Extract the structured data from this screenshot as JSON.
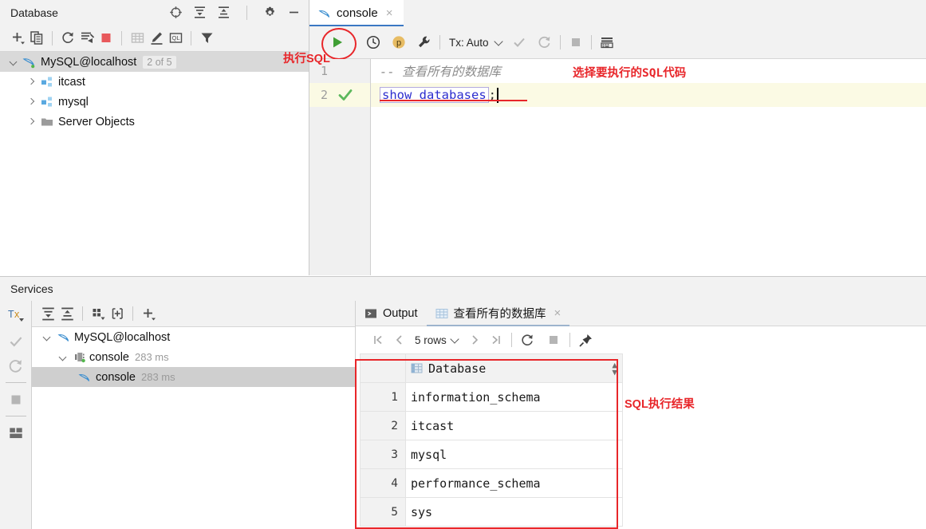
{
  "database_panel": {
    "title": "Database",
    "header_icons": [
      "locate-target-icon",
      "expand-all-icon",
      "collapse-all-icon",
      "settings-gear-icon",
      "minimize-icon"
    ],
    "toolbar_icons": [
      "add-plus-icon",
      "duplicate-icon",
      "refresh-icon",
      "run-script-icon",
      "stop-icon",
      "table-icon",
      "edit-pencil-icon",
      "query-ql-icon",
      "filter-icon"
    ],
    "tree": [
      {
        "label": "MySQL@localhost",
        "badge": "2 of 5",
        "icon": "mysql-dolphin-icon",
        "state": "open",
        "depth": 0,
        "selected": true
      },
      {
        "label": "itcast",
        "badge": "",
        "icon": "schema-icon",
        "state": "closed",
        "depth": 1,
        "selected": false
      },
      {
        "label": "mysql",
        "badge": "",
        "icon": "schema-icon",
        "state": "closed",
        "depth": 1,
        "selected": false
      },
      {
        "label": "Server Objects",
        "badge": "",
        "icon": "folder-icon",
        "state": "closed",
        "depth": 1,
        "selected": false
      }
    ]
  },
  "editor": {
    "tab": {
      "label": "console",
      "icon": "mysql-dolphin-icon",
      "close": "×"
    },
    "toolbar": {
      "run_icon": "run-play-icon",
      "history_icon": "history-clock-icon",
      "profile_icon": "profile-p-icon",
      "settings_icon": "wrench-icon",
      "tx_label": "Tx: Auto",
      "commit_icon": "commit-check-icon",
      "rollback_icon": "rollback-icon",
      "stop_icon": "stop-square-icon",
      "table_editor_icon": "data-editor-icon"
    },
    "lines": [
      {
        "num": "1",
        "status": "",
        "kind": "comment",
        "text": "--  查看所有的数据库",
        "current": false
      },
      {
        "num": "2",
        "status": "check-green-icon",
        "kind": "sql",
        "text": "show databases",
        "terminator": ";",
        "current": true
      }
    ]
  },
  "annotations": [
    {
      "text": "执行SQL",
      "name": "annotation-run-sql"
    },
    {
      "text": "选择要执行的SQL代码",
      "name": "annotation-select-sql"
    },
    {
      "text": "SQL执行结果",
      "name": "annotation-sql-result"
    }
  ],
  "services": {
    "title": "Services",
    "rail_icons": [
      "tx-dropdown-icon",
      "commit-check-icon",
      "rollback-icon",
      "stop-square-icon",
      "layout-icon"
    ],
    "toolbar_icons": [
      "expand-all-icon",
      "collapse-all-icon",
      "group-by-icon",
      "add-frame-icon",
      "add-plus-icon"
    ],
    "tree": [
      {
        "label": "MySQL@localhost",
        "time": "",
        "icon": "mysql-dolphin-icon",
        "state": "open",
        "depth": 0,
        "selected": false
      },
      {
        "label": "console",
        "time": "283 ms",
        "icon": "connection-icon",
        "state": "open",
        "depth": 1,
        "selected": false
      },
      {
        "label": "console",
        "time": "283 ms",
        "icon": "mysql-dolphin-icon",
        "state": "none",
        "depth": 2,
        "selected": true
      }
    ],
    "result_tabs": [
      {
        "label": "Output",
        "icon": "output-console-icon",
        "active": false,
        "closable": false
      },
      {
        "label": "查看所有的数据库",
        "icon": "grid-table-icon",
        "active": true,
        "closable": true
      }
    ],
    "result_toolbar": {
      "first_icon": "first-page-icon",
      "prev_icon": "prev-page-icon",
      "rows_label": "5 rows",
      "rows_chevron": "chevron-down-icon",
      "next_icon": "next-page-icon",
      "last_icon": "last-page-icon",
      "reload_icon": "reload-icon",
      "stop_icon": "stop-square-icon",
      "pin_icon": "pin-icon"
    },
    "grid": {
      "column_header": "Database",
      "column_icon": "column-key-icon",
      "sort_icon": "sort-updown-icon",
      "rows": [
        {
          "index": "1",
          "value": "information_schema"
        },
        {
          "index": "2",
          "value": "itcast"
        },
        {
          "index": "3",
          "value": "mysql"
        },
        {
          "index": "4",
          "value": "performance_schema"
        },
        {
          "index": "5",
          "value": "sys"
        }
      ]
    }
  },
  "colors": {
    "accent_red": "#e8262a",
    "tab_underline": "#3b78c3",
    "run_green": "#4a9b3c",
    "sql_blue": "#2d2dce",
    "panel_bg": "#f2f2f2"
  }
}
